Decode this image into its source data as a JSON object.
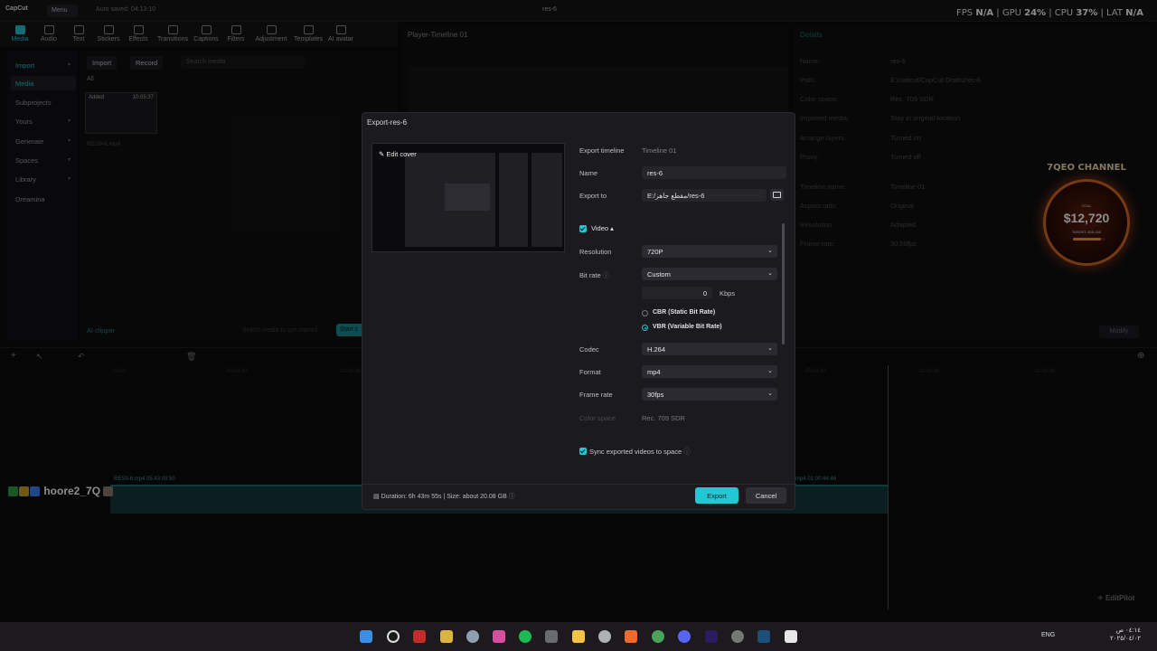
{
  "app": {
    "logo": "CapCut",
    "menu_label": "Menu",
    "autosave": "Auto saved: 04:13:10",
    "project_name": "res-6"
  },
  "stats": {
    "fps_label": "FPS",
    "fps": "N/A",
    "gpu_label": "GPU",
    "gpu": "24%",
    "cpu_label": "CPU",
    "cpu": "37%",
    "lat_label": "LAT",
    "lat": "N/A"
  },
  "tools": [
    "Media",
    "Audio",
    "Text",
    "Stickers",
    "Effects",
    "Transitions",
    "Captions",
    "Filters",
    "Adjustment",
    "Templates",
    "AI avatar"
  ],
  "sidenav": [
    "Import",
    "Media",
    "Subprojects",
    "Yours",
    "Generate",
    "Spaces",
    "Library",
    "Dreamina"
  ],
  "media": {
    "import_label": "Import",
    "record_label": "Record",
    "search_placeholder": "Search media",
    "section_all": "All",
    "clip_added": "Added",
    "clip_duration": "10:05:37",
    "clip_name": "RES9-6.mp4",
    "ai_clipper": "AI clipper",
    "hint": "Select media to get started",
    "start_label": "Start c"
  },
  "player": {
    "title": "Player-Timeline 01"
  },
  "details": {
    "title": "Details",
    "rows": [
      {
        "k": "Name:",
        "v": "res-6"
      },
      {
        "k": "Path:",
        "v": "E:/cabcut/CapCut Drafts/res-6"
      },
      {
        "k": "Color space:",
        "v": "Rec. 709 SDR"
      },
      {
        "k": "Imported media:",
        "v": "Stay in original location"
      },
      {
        "k": "Arrange layers",
        "v": "Turned on"
      },
      {
        "k": "Proxy:",
        "v": "Turned off"
      },
      {
        "k": "Timeline name:",
        "v": "Timeline 01"
      },
      {
        "k": "Aspect ratio:",
        "v": "Original"
      },
      {
        "k": "Resolution:",
        "v": "Adapted"
      },
      {
        "k": "Frame rate:",
        "v": "30.00fps"
      }
    ],
    "modify_label": "Modify"
  },
  "timeline": {
    "clip_left_label": "RES9-6.mp4  05:43:09:50",
    "clip_right_label": "mp4  01:00:44:46",
    "timecodes": [
      "00:00",
      "00:00:00",
      "10:00:00",
      "15:00:00",
      "18:00:00",
      "18:00:00"
    ]
  },
  "overlay": {
    "channel": "7QEO CHANNEL",
    "goal_caption": "GOAL",
    "amount": "$12,720",
    "target": "TARGET: $15,000",
    "progress": 0.85,
    "chat_user": "hoore2_7Q",
    "editpilot": "EditPilot"
  },
  "dialog": {
    "title": "Export-res-6",
    "edit_cover": "Edit cover",
    "export_timeline_label": "Export timeline",
    "export_timeline_value": "Timeline 01",
    "name_label": "Name",
    "name_value": "res-6",
    "export_to_label": "Export to",
    "export_to_value": "E:/مقطع جاهز/res-6",
    "video_label": "Video",
    "resolution_label": "Resolution",
    "resolution_value": "720P",
    "bitrate_label": "Bit rate",
    "bitrate_value": "Custom",
    "kbps_value": "0",
    "kbps_unit": "Kbps",
    "cbr_label": "CBR (Static Bit Rate)",
    "vbr_label": "VBR (Variable Bit Rate)",
    "codec_label": "Codec",
    "codec_value": "H.264",
    "format_label": "Format",
    "format_value": "mp4",
    "framerate_label": "Frame rate",
    "framerate_value": "30fps",
    "colorspace_label": "Color space",
    "colorspace_value": "Rec. 709 SDR",
    "sync_label": "Sync exported videos to space",
    "footer_info": "Duration: 6h 43m 55s | Size: about 20.08 GB",
    "export_button": "Export",
    "cancel_button": "Cancel"
  },
  "taskbar": {
    "lang": "ENG",
    "time": "٠٤:١٤ ص",
    "date": "٢٠٢٥/٠٤/٠٢"
  },
  "colors": {
    "accent": "#22c7d3",
    "bg": "#0b0b0c",
    "dialog": "#1b1b1f"
  }
}
